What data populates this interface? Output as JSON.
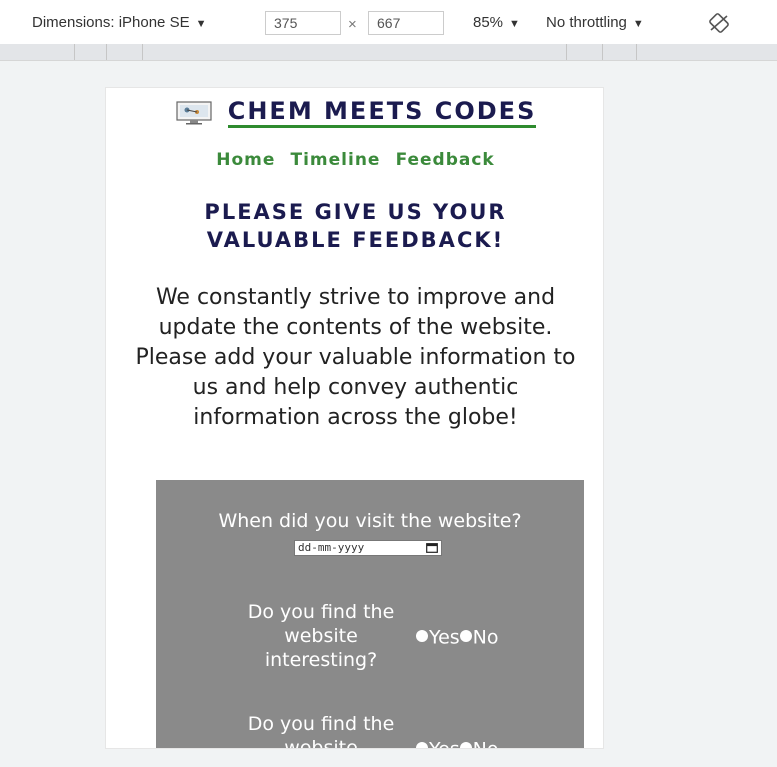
{
  "devtools": {
    "device_label": "Dimensions: iPhone SE",
    "width": "375",
    "times": "×",
    "height": "667",
    "zoom": "85%",
    "throttling": "No throttling",
    "dropdown_arrow": "▼",
    "rotate_icon": "rotate-icon"
  },
  "site": {
    "title": "CHEM MEETS CODES",
    "logo_icon": "chem-logo-icon",
    "nav": [
      "Home",
      "Timeline",
      "Feedback"
    ],
    "heading": "PLEASE GIVE US YOUR VALUABLE FEEDBACK!",
    "intro": "We constantly strive to improve and update the contents of the website. Please add your valuable information to us and help convey authentic information across the globe!",
    "form": {
      "visit_question": "When did you visit the website?",
      "date_placeholder": "dd-mm-yyyy",
      "questions": [
        {
          "label": "Do you find the website interesting?",
          "yes": "Yes",
          "no": "No"
        },
        {
          "label": "Do you find the website",
          "yes": "Yes",
          "no": "No"
        }
      ]
    }
  },
  "colors": {
    "brand_navy": "#1b1b4f",
    "nav_green": "#3b8a3b",
    "form_gray": "#8a8a8a"
  }
}
